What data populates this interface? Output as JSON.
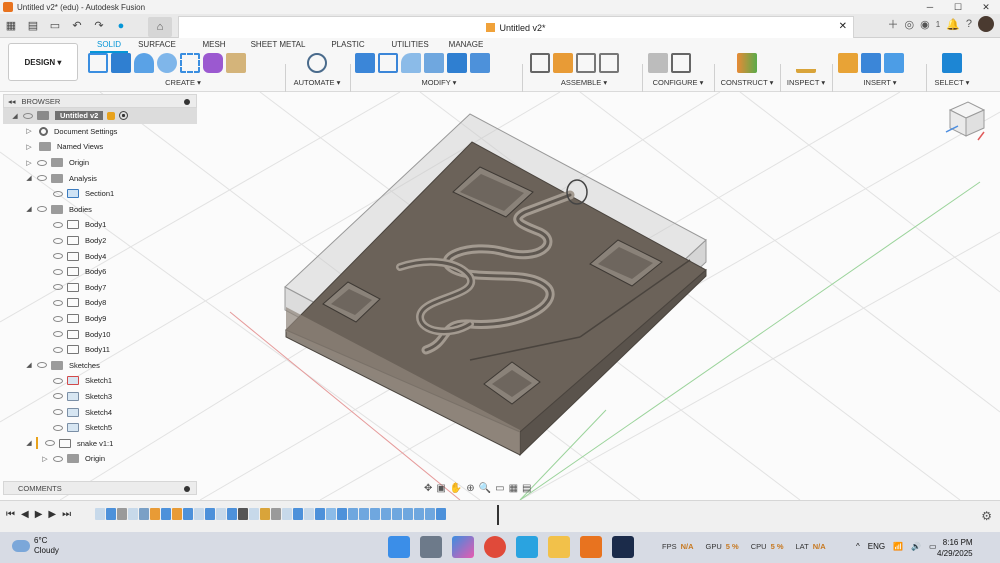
{
  "window": {
    "title": "Untitled v2* (edu) - Autodesk Fusion"
  },
  "doc_tab": {
    "title": "Untitled v2*",
    "close": "✕"
  },
  "counter": "1",
  "ribbon": {
    "design_button": "DESIGN ▾",
    "tabs": [
      "SOLID",
      "SURFACE",
      "MESH",
      "SHEET METAL",
      "PLASTIC",
      "UTILITIES",
      "MANAGE"
    ],
    "active_tab": "SOLID",
    "groups": [
      "CREATE ▾",
      "AUTOMATE ▾",
      "MODIFY ▾",
      "ASSEMBLE ▾",
      "CONFIGURE ▾",
      "CONSTRUCT ▾",
      "INSPECT ▾",
      "INSERT ▾",
      "SELECT ▾"
    ]
  },
  "browser": {
    "title": "BROWSER",
    "root": "Untitled v2",
    "items": [
      {
        "label": "Document Settings",
        "icon": "gear-icon"
      },
      {
        "label": "Named Views",
        "icon": "folder-icon"
      },
      {
        "label": "Origin",
        "icon": "folder-icon"
      },
      {
        "label": "Analysis",
        "icon": "folder-icon"
      },
      {
        "label": "Section1",
        "icon": "section-icon"
      },
      {
        "label": "Bodies",
        "icon": "folder-icon"
      },
      {
        "label": "Body1",
        "icon": "body-icon"
      },
      {
        "label": "Body2",
        "icon": "body-icon"
      },
      {
        "label": "Body4",
        "icon": "body-icon"
      },
      {
        "label": "Body6",
        "icon": "body-icon"
      },
      {
        "label": "Body7",
        "icon": "body-icon"
      },
      {
        "label": "Body8",
        "icon": "body-icon"
      },
      {
        "label": "Body9",
        "icon": "body-icon"
      },
      {
        "label": "Body10",
        "icon": "body-icon"
      },
      {
        "label": "Body11",
        "icon": "body-icon"
      },
      {
        "label": "Sketches",
        "icon": "folder-icon"
      },
      {
        "label": "Sketch1",
        "icon": "sketch-icon"
      },
      {
        "label": "Sketch3",
        "icon": "sketch-icon"
      },
      {
        "label": "Sketch4",
        "icon": "sketch-icon"
      },
      {
        "label": "Sketch5",
        "icon": "sketch-icon"
      },
      {
        "label": "snake v1:1",
        "icon": "component-icon"
      },
      {
        "label": "Origin",
        "icon": "folder-icon"
      }
    ]
  },
  "comments": {
    "title": "COMMENTS"
  },
  "taskbar": {
    "weather_temp": "6°C",
    "weather_desc": "Cloudy",
    "perf": [
      {
        "label": "FPS",
        "value": "N/A"
      },
      {
        "label": "GPU",
        "value": "5 %"
      },
      {
        "label": "CPU",
        "value": "5 %"
      },
      {
        "label": "LAT",
        "value": "N/A"
      }
    ],
    "lang": "ENG",
    "time": "8:16 PM",
    "date": "4/29/2025"
  },
  "colors": {
    "accent": "#0696d7",
    "model_dark": "#6b6259",
    "model_mid": "#8e857b",
    "grid": "#e4e4e4"
  }
}
